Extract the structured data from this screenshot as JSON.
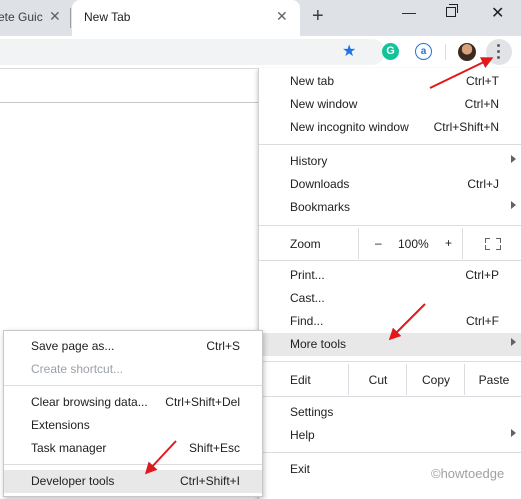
{
  "tabs": [
    {
      "label": "ete Guic",
      "close": "✕"
    },
    {
      "label": "New Tab",
      "close": "✕"
    }
  ],
  "new_tab_symbol": "+",
  "window_controls": {
    "minimize": "—",
    "close": "✕"
  },
  "toolbar": {
    "bookmark_icon": "star-icon",
    "grammarly_label": "G",
    "extension_label": "a"
  },
  "main_menu": {
    "items": [
      {
        "label": "New tab",
        "shortcut": "Ctrl+T"
      },
      {
        "label": "New window",
        "shortcut": "Ctrl+N"
      },
      {
        "label": "New incognito window",
        "shortcut": "Ctrl+Shift+N"
      },
      {
        "label": "History",
        "shortcut": ""
      },
      {
        "label": "Downloads",
        "shortcut": "Ctrl+J"
      },
      {
        "label": "Bookmarks",
        "shortcut": ""
      },
      {
        "label": "Print...",
        "shortcut": "Ctrl+P"
      },
      {
        "label": "Cast...",
        "shortcut": ""
      },
      {
        "label": "Find...",
        "shortcut": "Ctrl+F"
      },
      {
        "label": "More tools",
        "shortcut": ""
      },
      {
        "label": "Settings",
        "shortcut": ""
      },
      {
        "label": "Help",
        "shortcut": ""
      },
      {
        "label": "Exit",
        "shortcut": ""
      }
    ],
    "zoom": {
      "label": "Zoom",
      "minus": "–",
      "value": "100%",
      "plus": "+"
    },
    "edit": {
      "label": "Edit",
      "cut": "Cut",
      "copy": "Copy",
      "paste": "Paste"
    }
  },
  "sub_menu": {
    "items": [
      {
        "label": "Save page as...",
        "shortcut": "Ctrl+S"
      },
      {
        "label": "Create shortcut...",
        "shortcut": ""
      },
      {
        "label": "Clear browsing data...",
        "shortcut": "Ctrl+Shift+Del"
      },
      {
        "label": "Extensions",
        "shortcut": ""
      },
      {
        "label": "Task manager",
        "shortcut": "Shift+Esc"
      },
      {
        "label": "Developer tools",
        "shortcut": "Ctrl+Shift+I"
      }
    ]
  },
  "watermark": "©howtoedge",
  "colors": {
    "arrow": "#e0191d",
    "accent": "#1a73e8",
    "highlight": "#e8e8e8"
  }
}
